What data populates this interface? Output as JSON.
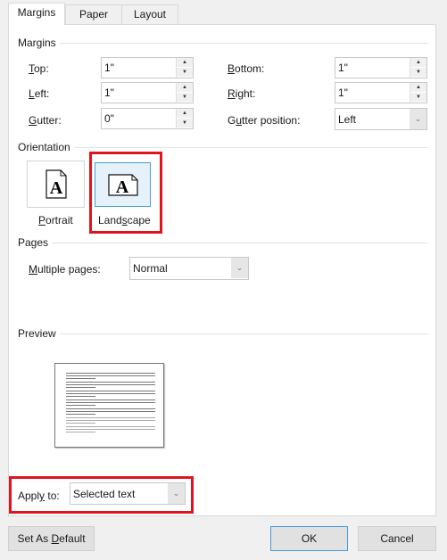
{
  "tabs": [
    {
      "label": "Margins",
      "selected": true
    },
    {
      "label": "Paper",
      "selected": false
    },
    {
      "label": "Layout",
      "selected": false
    }
  ],
  "margins": {
    "group_label": "Margins",
    "top": {
      "pre": "",
      "key": "T",
      "post": "op:",
      "value": "1\""
    },
    "left": {
      "pre": "",
      "key": "L",
      "post": "eft:",
      "value": "1\""
    },
    "gutter": {
      "pre": "",
      "key": "G",
      "post": "utter:",
      "value": "0\""
    },
    "bottom": {
      "pre": "",
      "key": "B",
      "post": "ottom:",
      "value": "1\""
    },
    "right": {
      "pre": "",
      "key": "R",
      "post": "ight:",
      "value": "1\""
    },
    "gutter_position": {
      "pre": "G",
      "key": "u",
      "post": "tter position:",
      "value": "Left"
    }
  },
  "orientation": {
    "group_label": "Orientation",
    "portrait": {
      "pre": "",
      "key": "P",
      "post": "ortrait",
      "selected": false
    },
    "landscape": {
      "pre": "Land",
      "key": "s",
      "post": "cape",
      "selected": true
    },
    "icon_letter": "A"
  },
  "pages": {
    "group_label": "Pages",
    "multiple": {
      "pre": "",
      "key": "M",
      "post": "ultiple pages:",
      "value": "Normal"
    }
  },
  "preview": {
    "group_label": "Preview"
  },
  "apply_to": {
    "pre": "Appl",
    "key": "y",
    "post": " to:",
    "value": "Selected text"
  },
  "buttons": {
    "default": {
      "pre": "Set As ",
      "key": "D",
      "post": "efault"
    },
    "ok": "OK",
    "cancel": "Cancel"
  },
  "colors": {
    "highlight": "#e0141c",
    "selected_border": "#4a9bd9"
  }
}
